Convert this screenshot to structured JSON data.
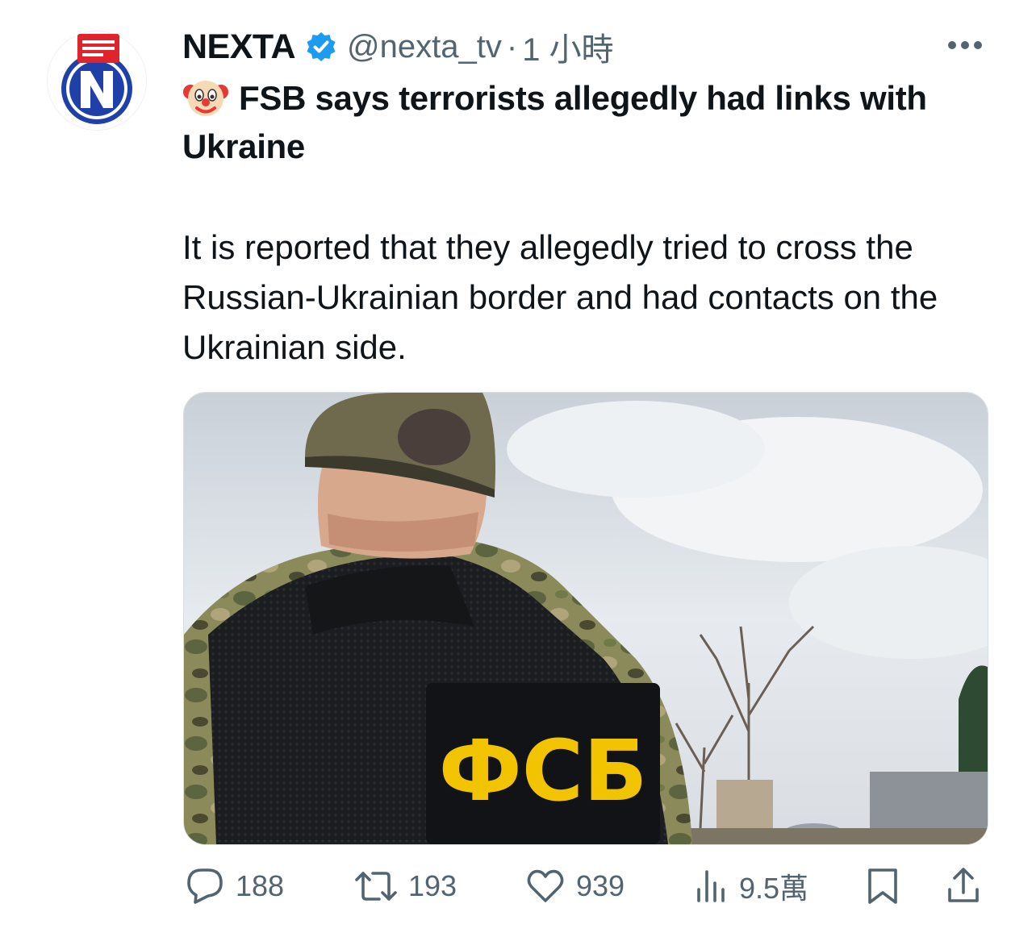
{
  "tweet": {
    "display_name": "NEXTA",
    "handle": "@nexta_tv",
    "separator": "·",
    "time": "1 小時",
    "title": "FSB says terrorists allegedly had links with Ukraine",
    "body": "It is reported that they allegedly tried to cross the Russian-Ukrainian border and had contacts on the Ukrainian side.",
    "image_text": "ФСБ"
  },
  "actions": {
    "replies": "188",
    "reposts": "193",
    "likes": "939",
    "views": "9.5萬"
  },
  "icons": {
    "verified": "verified-badge-icon",
    "more": "more-options-icon",
    "reply": "reply-bubble-icon",
    "repost": "repost-arrows-icon",
    "like": "heart-icon",
    "views": "bar-chart-icon",
    "bookmark": "bookmark-icon",
    "share": "share-upload-icon",
    "emoji": "clown-face-emoji"
  },
  "colors": {
    "text_primary": "#0f1419",
    "text_secondary": "#536471",
    "verified_blue": "#1d9bf0",
    "nexta_blue": "#1e40a8",
    "nexta_red": "#e0242d"
  }
}
